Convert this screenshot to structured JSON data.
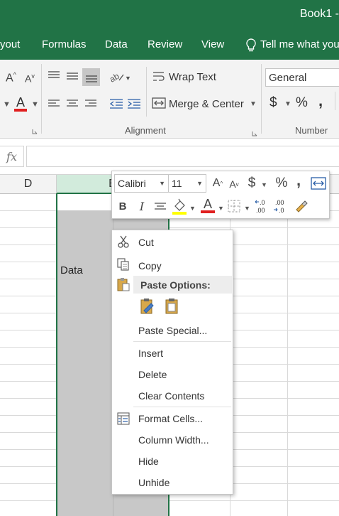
{
  "window": {
    "title": "Book1 -"
  },
  "tabs": [
    "yout",
    "Formulas",
    "Data",
    "Review",
    "View"
  ],
  "tell_me": "Tell me what you",
  "ribbon": {
    "wrap_text": "Wrap Text",
    "merge_center": "Merge & Center",
    "number_format": "General",
    "currency_symbol": "$",
    "percent_symbol": "%",
    "comma_symbol": ",",
    "alignment_label": "Alignment",
    "number_label": "Number"
  },
  "formula_bar": {
    "fx": "fx",
    "value": ""
  },
  "columns": [
    "D",
    "E"
  ],
  "cells": {
    "e_data": "Data"
  },
  "mini_toolbar": {
    "font": "Calibri",
    "size": "11",
    "grow": "A",
    "shrink": "A",
    "currency": "$",
    "percent": "%",
    "comma": ",",
    "bold": "B",
    "italic": "I",
    "font_color_letter": "A",
    "inc_decimal": "←.0\n.00",
    "dec_decimal": ".00\n→.0"
  },
  "context_menu": {
    "cut": "Cut",
    "copy": "Copy",
    "paste_options": "Paste Options:",
    "paste_special": "Paste Special...",
    "insert": "Insert",
    "delete": "Delete",
    "clear_contents": "Clear Contents",
    "format_cells": "Format Cells...",
    "column_width": "Column Width...",
    "hide": "Hide",
    "unhide": "Unhide"
  },
  "colors": {
    "excel_green": "#217346",
    "selection_gray": "#c8c8c8",
    "selection_border": "#217346",
    "header_highlight": "#d2ebdc",
    "font_color_red": "#e01f1f",
    "fill_yellow": "#ffff00"
  }
}
